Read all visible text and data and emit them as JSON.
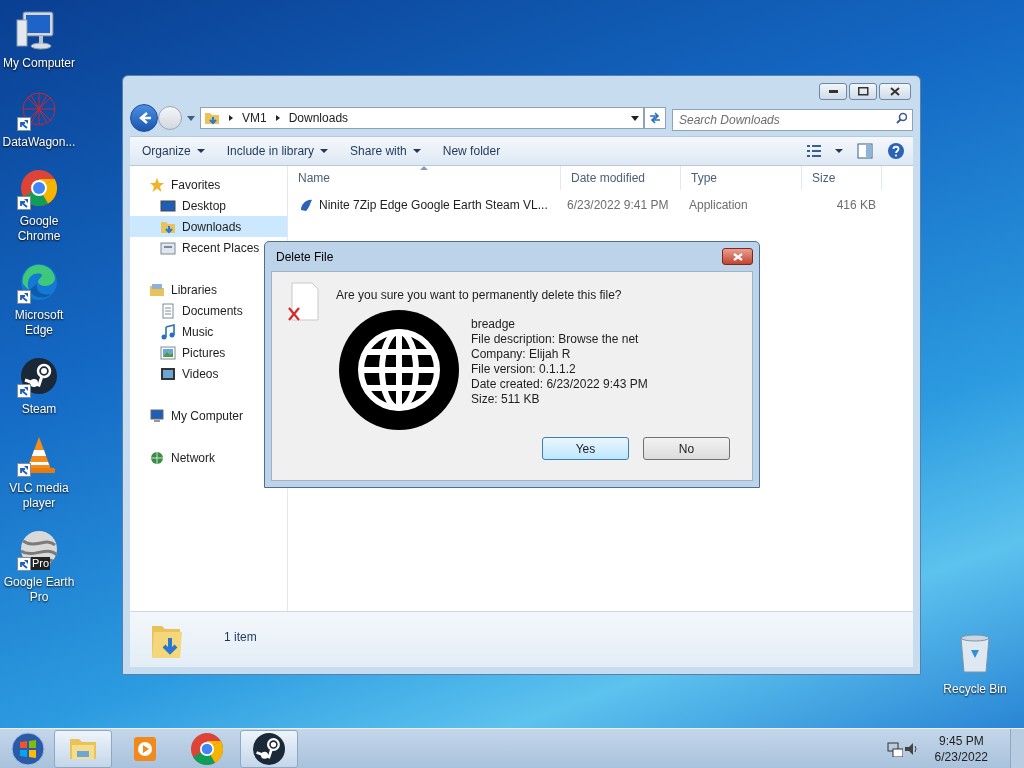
{
  "desktop_icons": [
    {
      "label": "My Computer",
      "kind": "computer",
      "shortcut": false
    },
    {
      "label": "DataWagon...",
      "kind": "datawagon",
      "shortcut": true
    },
    {
      "label": "Google Chrome",
      "kind": "chrome",
      "shortcut": true
    },
    {
      "label": "Microsoft Edge",
      "kind": "edge",
      "shortcut": true
    },
    {
      "label": "Steam",
      "kind": "steam",
      "shortcut": true
    },
    {
      "label": "VLC media player",
      "kind": "vlc",
      "shortcut": true
    },
    {
      "label": "Google Earth Pro",
      "kind": "earth",
      "shortcut": true,
      "badge": "Pro"
    }
  ],
  "recycle_bin": {
    "label": "Recycle Bin"
  },
  "explorer": {
    "address": [
      "VM1",
      "Downloads"
    ],
    "search": {
      "placeholder": "Search Downloads"
    },
    "toolbar": [
      {
        "label": "Organize",
        "dropdown": true
      },
      {
        "label": "Include in library",
        "dropdown": true
      },
      {
        "label": "Share with",
        "dropdown": true
      },
      {
        "label": "New folder",
        "dropdown": false
      }
    ],
    "nav": [
      {
        "label": "Favorites",
        "kind": "star",
        "selected": false,
        "children": [
          {
            "label": "Desktop",
            "kind": "desktop",
            "selected": false
          },
          {
            "label": "Downloads",
            "kind": "downloads",
            "selected": true
          },
          {
            "label": "Recent Places",
            "kind": "recent",
            "selected": false
          }
        ]
      },
      {
        "label": "Libraries",
        "kind": "library",
        "selected": false,
        "children": [
          {
            "label": "Documents",
            "kind": "documents",
            "selected": false
          },
          {
            "label": "Music",
            "kind": "music",
            "selected": false
          },
          {
            "label": "Pictures",
            "kind": "pictures",
            "selected": false
          },
          {
            "label": "Videos",
            "kind": "videos",
            "selected": false
          }
        ]
      },
      {
        "label": "My Computer",
        "kind": "computer",
        "selected": false
      },
      {
        "label": "Network",
        "kind": "network",
        "selected": false
      }
    ],
    "columns": [
      {
        "label": "Name",
        "sorted": true
      },
      {
        "label": "Date modified",
        "sorted": false
      },
      {
        "label": "Type",
        "sorted": false
      },
      {
        "label": "Size",
        "sorted": false
      }
    ],
    "rows": [
      {
        "name": "Ninite 7Zip Edge Google Earth Steam VL...",
        "date": "6/23/2022 9:41 PM",
        "type": "Application",
        "size": "416 KB"
      }
    ],
    "status": "1 item"
  },
  "dialog": {
    "title": "Delete File",
    "question": "Are you sure you want to permanently delete this file?",
    "details": [
      "breadge",
      "File description: Browse the net",
      "Company: Elijah R",
      "File version: 0.1.1.2",
      "Date created: 6/23/2022 9:43 PM",
      "Size: 511 KB"
    ],
    "buttons": [
      {
        "label": "Yes",
        "default": true
      },
      {
        "label": "No",
        "default": false
      }
    ]
  },
  "taskbar": {
    "items": [
      {
        "kind": "explorer",
        "active": true
      },
      {
        "kind": "media",
        "active": false
      },
      {
        "kind": "chrome",
        "active": false
      },
      {
        "kind": "steam",
        "active": true
      }
    ],
    "time": "9:45 PM",
    "date": "6/23/2022"
  }
}
